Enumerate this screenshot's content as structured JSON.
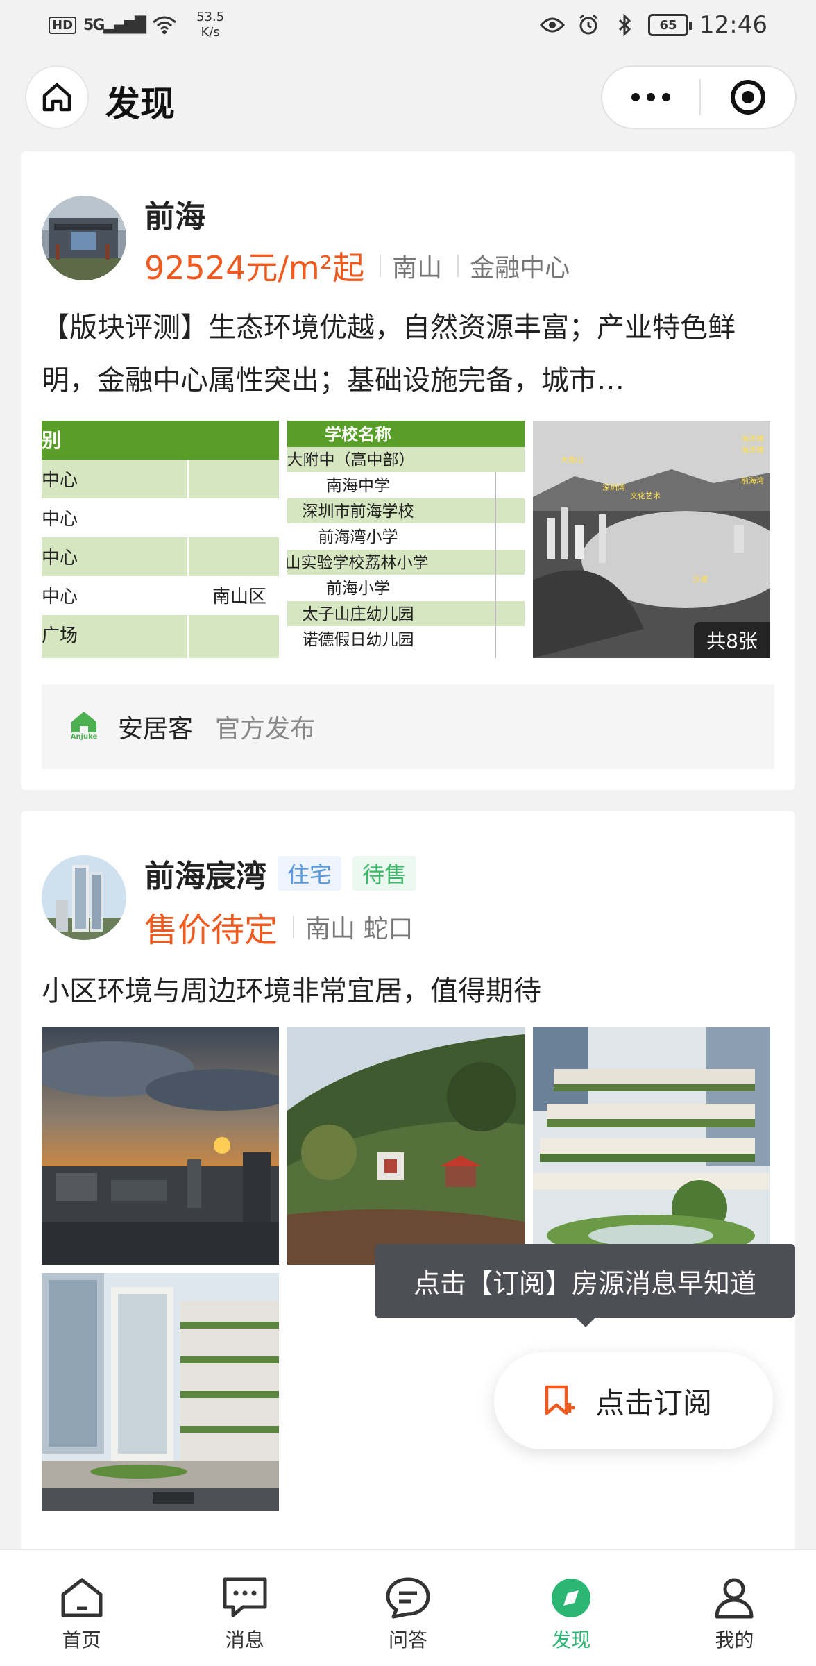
{
  "status_bar": {
    "hd": "HD",
    "signal": "5G",
    "speed_value": "53.5",
    "speed_unit": "K/s",
    "battery": "65",
    "time": "12:46"
  },
  "header": {
    "title": "发现"
  },
  "cards": [
    {
      "title": "前海",
      "price": "92524元/m²起",
      "district": "南山",
      "area": "金融中心",
      "description": "【版块评测】生态环境优越，自然资源丰富；产业特色鲜明，金融中心属性突出；基础设施完备，城市…",
      "image_count_badge": "共8张",
      "school_table": {
        "header": "学校名称",
        "rows": [
          "深大附中（高中部）",
          "南海中学",
          "深圳市前海学校",
          "前海湾小学",
          "山实验学校荔林小学",
          "前海小学",
          "太子山庄幼儿园",
          "诺德假日幼儿园"
        ]
      },
      "table_crop": {
        "header": "别",
        "rows": [
          "中心",
          "中心",
          "中心",
          "中心",
          "广场"
        ],
        "side_text": "南山区"
      },
      "map_labels": [
        "大南山",
        "海洋博",
        "海洋博",
        "沙滩",
        "深圳湾",
        "文化艺术",
        "前海湾"
      ],
      "source_name": "安居客",
      "source_logo_text": "Anjuke",
      "source_note": "官方发布"
    },
    {
      "title": "前海宸湾",
      "tag_type": "住宅",
      "tag_status": "待售",
      "price": "售价待定",
      "location": "南山 蛇口",
      "description": "小区环境与周边环境非常宜居，值得期待"
    }
  ],
  "tooltip": "点击【订阅】房源消息早知道",
  "subscribe_label": "点击订阅",
  "tabbar": [
    {
      "label": "首页",
      "icon": "home-icon"
    },
    {
      "label": "消息",
      "icon": "message-icon"
    },
    {
      "label": "问答",
      "icon": "qa-icon"
    },
    {
      "label": "发现",
      "icon": "discover-icon",
      "active": true
    },
    {
      "label": "我的",
      "icon": "profile-icon"
    }
  ],
  "colors": {
    "accent_green": "#2bb673",
    "price_orange": "#f05a1e",
    "tag_blue": "#5b9be0",
    "tag_green": "#3cb96a"
  }
}
